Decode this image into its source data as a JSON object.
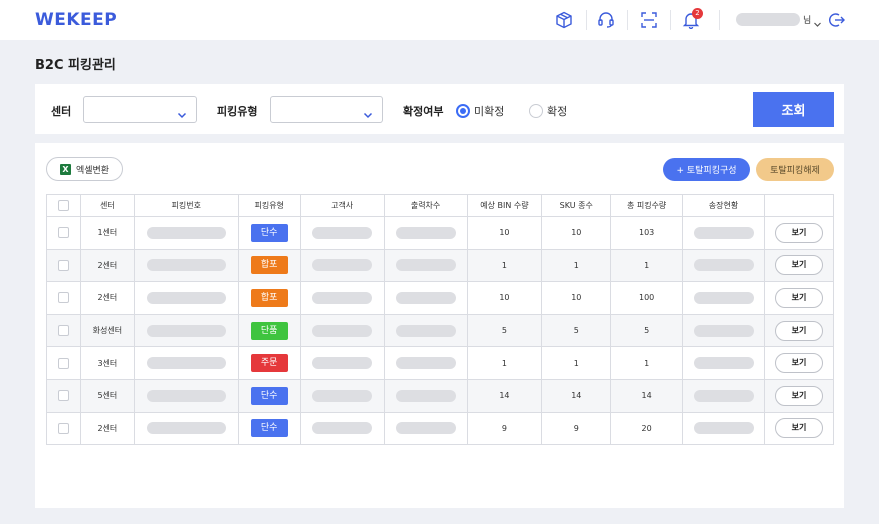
{
  "header": {
    "logo": "WEKEEP",
    "notification_count": "2",
    "user_suffix": "님",
    "icons": [
      "box-icon",
      "headset-icon",
      "scan-icon",
      "bell-icon",
      "chevron-down-icon",
      "logout-icon"
    ]
  },
  "page": {
    "title": "B2C 피킹관리"
  },
  "filter": {
    "center_label": "센터",
    "center_value": "",
    "picking_type_label": "피킹유형",
    "picking_type_value": "",
    "confirm_label": "확정여부",
    "radio_unconfirmed": "미확정",
    "radio_confirmed": "확정",
    "selected_radio": "미확정",
    "search_button": "조회"
  },
  "toolbar": {
    "excel_button": "엑셀변환",
    "compose_button": "+ 토탈피킹구성",
    "release_button": "토탈피킹해제"
  },
  "table": {
    "headers": [
      "",
      "센터",
      "피킹번호",
      "피킹유형",
      "고객사",
      "출력차수",
      "예상 BIN 수량",
      "SKU 종수",
      "총 피킹수량",
      "송장현황",
      ""
    ],
    "view_label": "보기",
    "rows": [
      {
        "center": "1센터",
        "type": "단수",
        "bin": "10",
        "sku": "10",
        "total": "103"
      },
      {
        "center": "2센터",
        "type": "합포",
        "bin": "1",
        "sku": "1",
        "total": "1"
      },
      {
        "center": "2센터",
        "type": "합포",
        "bin": "10",
        "sku": "10",
        "total": "100"
      },
      {
        "center": "화성센터",
        "type": "단품",
        "bin": "5",
        "sku": "5",
        "total": "5"
      },
      {
        "center": "3센터",
        "type": "주문",
        "bin": "1",
        "sku": "1",
        "total": "1"
      },
      {
        "center": "5센터",
        "type": "단수",
        "bin": "14",
        "sku": "14",
        "total": "14"
      },
      {
        "center": "2센터",
        "type": "단수",
        "bin": "9",
        "sku": "9",
        "total": "20"
      }
    ]
  },
  "colors": {
    "accent": "#4a72ef",
    "tag_단수": "#4a72ef",
    "tag_합포": "#ee7a1a",
    "tag_단품": "#3fc43f",
    "tag_주문": "#e5383b",
    "release_button": "#f2c98a"
  }
}
